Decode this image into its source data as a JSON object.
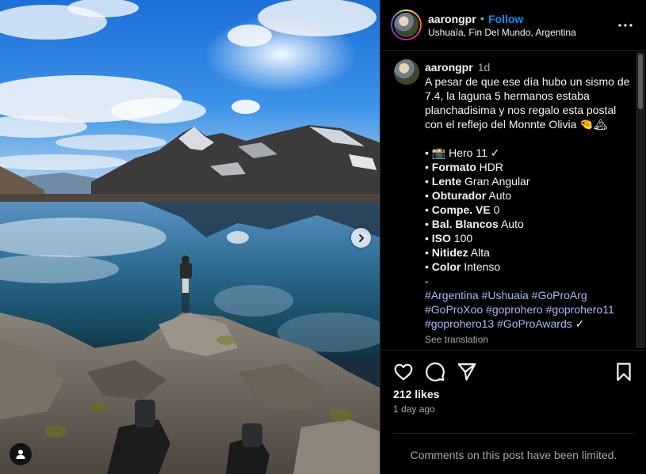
{
  "header": {
    "username": "aarongpr",
    "separator": "•",
    "follow_label": "Follow",
    "location": "Ushuaïa, Fin Del Mundo, Argentina",
    "more_icon": "more-horizontal-icon"
  },
  "caption": {
    "username": "aarongpr",
    "time": "1d",
    "text": "A pesar de que ese día hubo un sismo de 7.4, la laguna 5 hermanos estaba planchadisima y nos regalo esta postal con el reflejo del Monnte Olivia 🤏🏔",
    "specs": [
      {
        "bullet": "•",
        "label": "📸",
        "value": "Hero 11 ✓",
        "bold": false
      },
      {
        "bullet": "•",
        "label": "Formato",
        "value": "HDR",
        "bold": true
      },
      {
        "bullet": "•",
        "label": "Lente",
        "value": "Gran Angular",
        "bold": true
      },
      {
        "bullet": "•",
        "label": "Obturador",
        "value": "Auto",
        "bold": true
      },
      {
        "bullet": "•",
        "label": "Compe. VE",
        "value": "0",
        "bold": true
      },
      {
        "bullet": "•",
        "label": "Bal. Blancos",
        "value": "Auto",
        "bold": true
      },
      {
        "bullet": "•",
        "label": "ISO",
        "value": "100",
        "bold": true
      },
      {
        "bullet": "•",
        "label": "Nitidez",
        "value": "Alta",
        "bold": true
      },
      {
        "bullet": "•",
        "label": "Color",
        "value": "Intenso",
        "bold": true
      }
    ],
    "dash": "-",
    "hashtags": [
      "#Argentina",
      "#Ushuaia",
      "#GoProArg",
      "#GoProXoo",
      "#goprohero",
      "#goprohero11",
      "#goprohero13",
      "#GoProAwards"
    ],
    "hashtag_suffix": "✓",
    "see_translation": "See translation"
  },
  "actions": {
    "like_icon": "heart-icon",
    "comment_icon": "comment-icon",
    "share_icon": "send-icon",
    "save_icon": "bookmark-icon",
    "likes": "212 likes",
    "time_ago": "1 day ago"
  },
  "footer": {
    "comments_limited": "Comments on this post have been limited."
  },
  "photo": {
    "next_icon": "chevron-right-icon",
    "tagged_icon": "user-tag-icon"
  },
  "colors": {
    "background": "#000000",
    "follow": "#0095f6",
    "hashtag": "#a8b8ff",
    "muted": "#a8a8a8",
    "divider": "#262626"
  }
}
